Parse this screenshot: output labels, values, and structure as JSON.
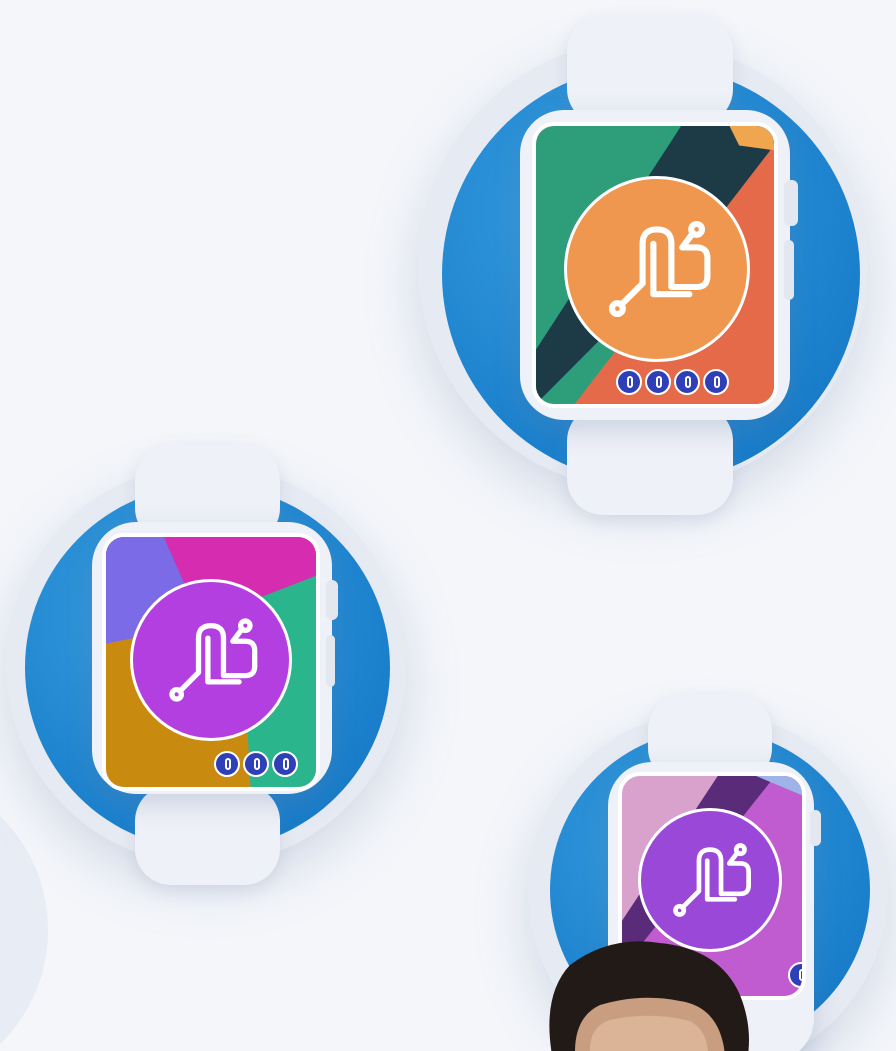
{
  "scene": {
    "watches": [
      {
        "id": "watch-orange",
        "logo_color": "#f0974f",
        "screen_palette": [
          "#2e9e7a",
          "#1d3b46",
          "#e46a4a",
          "#f0974f"
        ],
        "app_icon_count": 4
      },
      {
        "id": "watch-magenta",
        "logo_color": "#b43fe0",
        "screen_palette": [
          "#d52cb0",
          "#7b6be6",
          "#2bb58c",
          "#c98a10"
        ],
        "app_icon_count": 3
      },
      {
        "id": "watch-violet",
        "logo_color": "#9a48d8",
        "screen_palette": [
          "#d9a2cc",
          "#5a2b78",
          "#c05cd0",
          "#b44ccd"
        ],
        "app_icon_count": 1
      }
    ],
    "ring_color": "#1a7fcc",
    "device_color": "#eef1f7",
    "background_color": "#f4f6fa"
  },
  "icons": {
    "logo": "ls-monogram-icon",
    "app_icon": "watch-app-icon"
  }
}
